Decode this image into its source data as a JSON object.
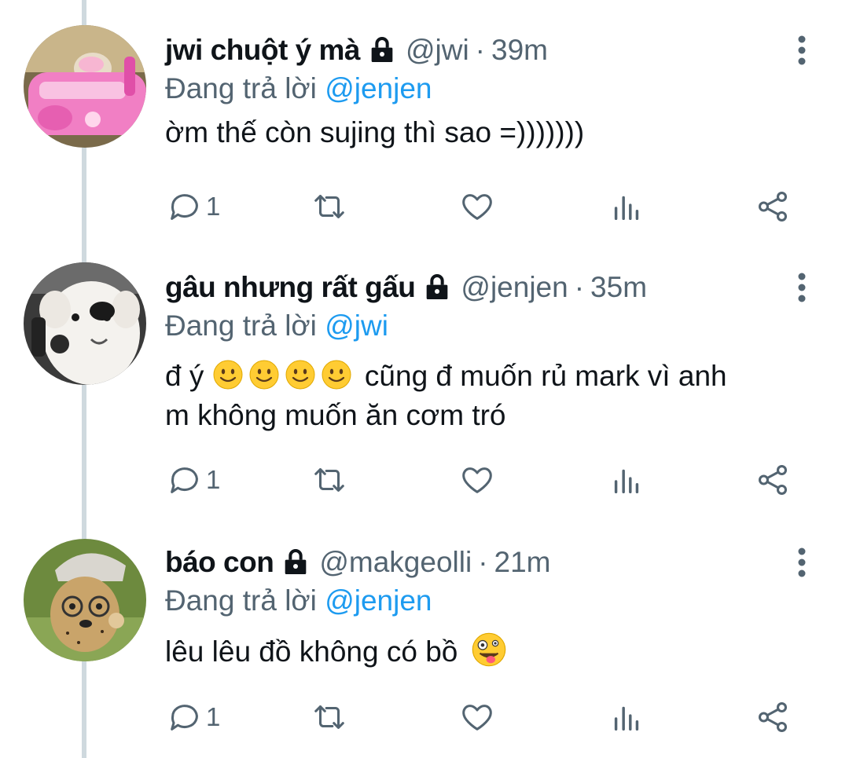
{
  "tweets": [
    {
      "name": "jwi chuột ý mà",
      "handle": "@jwi",
      "separator": "·",
      "time": "39m",
      "replying_prefix": "Đang trả lời",
      "replying_to": "@jenjen",
      "text_lines": [
        "ờm thế còn sujing thì sao =)))))))"
      ],
      "reply_count": "1",
      "avatar_icon": "hamster-in-pink-car-avatar"
    },
    {
      "name": "gâu nhưng rất gấu",
      "handle": "@jenjen",
      "separator": "·",
      "time": "35m",
      "replying_prefix": "Đang trả lời",
      "replying_to": "@jwi",
      "text_line1_before": "đ ý",
      "text_line1_after": "cũng đ muốn rủ mark vì anh",
      "text_line2": "m không muốn ăn cơm tró",
      "emoji_count": 4,
      "reply_count": "1",
      "avatar_icon": "white-dog-avatar"
    },
    {
      "name": "báo con",
      "handle": "@makgeolli",
      "separator": "·",
      "time": "21m",
      "replying_prefix": "Đang trả lời",
      "replying_to": "@jenjen",
      "text_before": "lêu lêu đồ không có bồ",
      "reply_count": "1",
      "avatar_icon": "cheetah-cub-avatar"
    }
  ],
  "colors": {
    "text": "#0f1419",
    "secondary": "#536471",
    "link": "#1d9bf0",
    "thread_line": "#cfd9de"
  }
}
